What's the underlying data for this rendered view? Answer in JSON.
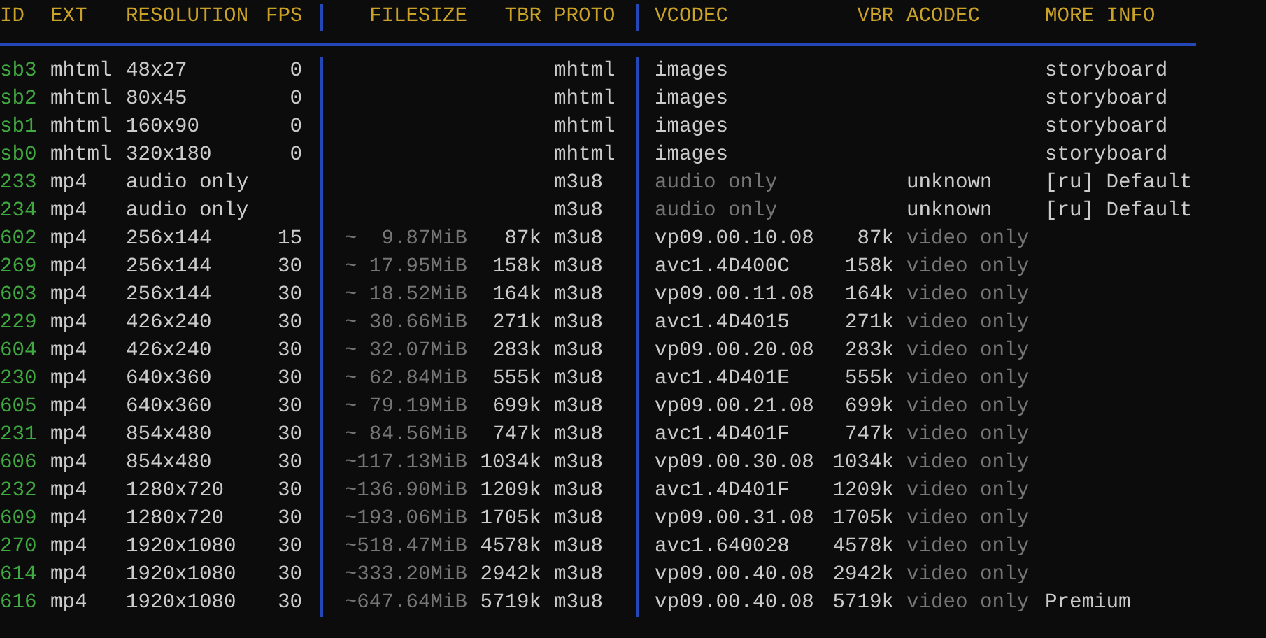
{
  "table": {
    "columns": [
      "ID",
      "EXT",
      "RESOLUTION",
      "FPS",
      "FILESIZE",
      "TBR",
      "PROTO",
      "VCODEC",
      "VBR",
      "ACODEC",
      "MORE INFO"
    ],
    "rows": [
      {
        "kind": "storyboard",
        "id": "sb3",
        "ext": "mhtml",
        "resolution": "48x27",
        "fps": "0",
        "proto": "mhtml",
        "vcodec": "images",
        "more_info": "storyboard"
      },
      {
        "kind": "storyboard",
        "id": "sb2",
        "ext": "mhtml",
        "resolution": "80x45",
        "fps": "0",
        "proto": "mhtml",
        "vcodec": "images",
        "more_info": "storyboard"
      },
      {
        "kind": "storyboard",
        "id": "sb1",
        "ext": "mhtml",
        "resolution": "160x90",
        "fps": "0",
        "proto": "mhtml",
        "vcodec": "images",
        "more_info": "storyboard"
      },
      {
        "kind": "storyboard",
        "id": "sb0",
        "ext": "mhtml",
        "resolution": "320x180",
        "fps": "0",
        "proto": "mhtml",
        "vcodec": "images",
        "more_info": "storyboard"
      },
      {
        "kind": "audio",
        "id": "233",
        "ext": "mp4",
        "resolution": "audio only",
        "proto": "m3u8",
        "vcodec": "audio only",
        "acodec": "unknown",
        "more_info": "[ru] Default"
      },
      {
        "kind": "audio",
        "id": "234",
        "ext": "mp4",
        "resolution": "audio only",
        "proto": "m3u8",
        "vcodec": "audio only",
        "acodec": "unknown",
        "more_info": "[ru] Default"
      },
      {
        "kind": "video",
        "id": "602",
        "ext": "mp4",
        "resolution": "256x144",
        "fps": "15",
        "filesize": "~  9.87MiB",
        "tbr": "87k",
        "proto": "m3u8",
        "vcodec": "vp09.00.10.08",
        "vbr": "87k",
        "acodec": "video only"
      },
      {
        "kind": "video",
        "id": "269",
        "ext": "mp4",
        "resolution": "256x144",
        "fps": "30",
        "filesize": "~ 17.95MiB",
        "tbr": "158k",
        "proto": "m3u8",
        "vcodec": "avc1.4D400C",
        "vbr": "158k",
        "acodec": "video only"
      },
      {
        "kind": "video",
        "id": "603",
        "ext": "mp4",
        "resolution": "256x144",
        "fps": "30",
        "filesize": "~ 18.52MiB",
        "tbr": "164k",
        "proto": "m3u8",
        "vcodec": "vp09.00.11.08",
        "vbr": "164k",
        "acodec": "video only"
      },
      {
        "kind": "video",
        "id": "229",
        "ext": "mp4",
        "resolution": "426x240",
        "fps": "30",
        "filesize": "~ 30.66MiB",
        "tbr": "271k",
        "proto": "m3u8",
        "vcodec": "avc1.4D4015",
        "vbr": "271k",
        "acodec": "video only"
      },
      {
        "kind": "video",
        "id": "604",
        "ext": "mp4",
        "resolution": "426x240",
        "fps": "30",
        "filesize": "~ 32.07MiB",
        "tbr": "283k",
        "proto": "m3u8",
        "vcodec": "vp09.00.20.08",
        "vbr": "283k",
        "acodec": "video only"
      },
      {
        "kind": "video",
        "id": "230",
        "ext": "mp4",
        "resolution": "640x360",
        "fps": "30",
        "filesize": "~ 62.84MiB",
        "tbr": "555k",
        "proto": "m3u8",
        "vcodec": "avc1.4D401E",
        "vbr": "555k",
        "acodec": "video only"
      },
      {
        "kind": "video",
        "id": "605",
        "ext": "mp4",
        "resolution": "640x360",
        "fps": "30",
        "filesize": "~ 79.19MiB",
        "tbr": "699k",
        "proto": "m3u8",
        "vcodec": "vp09.00.21.08",
        "vbr": "699k",
        "acodec": "video only"
      },
      {
        "kind": "video",
        "id": "231",
        "ext": "mp4",
        "resolution": "854x480",
        "fps": "30",
        "filesize": "~ 84.56MiB",
        "tbr": "747k",
        "proto": "m3u8",
        "vcodec": "avc1.4D401F",
        "vbr": "747k",
        "acodec": "video only"
      },
      {
        "kind": "video",
        "id": "606",
        "ext": "mp4",
        "resolution": "854x480",
        "fps": "30",
        "filesize": "~117.13MiB",
        "tbr": "1034k",
        "proto": "m3u8",
        "vcodec": "vp09.00.30.08",
        "vbr": "1034k",
        "acodec": "video only"
      },
      {
        "kind": "video",
        "id": "232",
        "ext": "mp4",
        "resolution": "1280x720",
        "fps": "30",
        "filesize": "~136.90MiB",
        "tbr": "1209k",
        "proto": "m3u8",
        "vcodec": "avc1.4D401F",
        "vbr": "1209k",
        "acodec": "video only"
      },
      {
        "kind": "video",
        "id": "609",
        "ext": "mp4",
        "resolution": "1280x720",
        "fps": "30",
        "filesize": "~193.06MiB",
        "tbr": "1705k",
        "proto": "m3u8",
        "vcodec": "vp09.00.31.08",
        "vbr": "1705k",
        "acodec": "video only"
      },
      {
        "kind": "video",
        "id": "270",
        "ext": "mp4",
        "resolution": "1920x1080",
        "fps": "30",
        "filesize": "~518.47MiB",
        "tbr": "4578k",
        "proto": "m3u8",
        "vcodec": "avc1.640028",
        "vbr": "4578k",
        "acodec": "video only"
      },
      {
        "kind": "video",
        "id": "614",
        "ext": "mp4",
        "resolution": "1920x1080",
        "fps": "30",
        "filesize": "~333.20MiB",
        "tbr": "2942k",
        "proto": "m3u8",
        "vcodec": "vp09.00.40.08",
        "vbr": "2942k",
        "acodec": "video only"
      },
      {
        "kind": "video",
        "id": "616",
        "ext": "mp4",
        "resolution": "1920x1080",
        "fps": "30",
        "filesize": "~647.64MiB",
        "tbr": "5719k",
        "proto": "m3u8",
        "vcodec": "vp09.00.40.08",
        "vbr": "5719k",
        "acodec": "video only",
        "more_info": "Premium"
      }
    ]
  }
}
